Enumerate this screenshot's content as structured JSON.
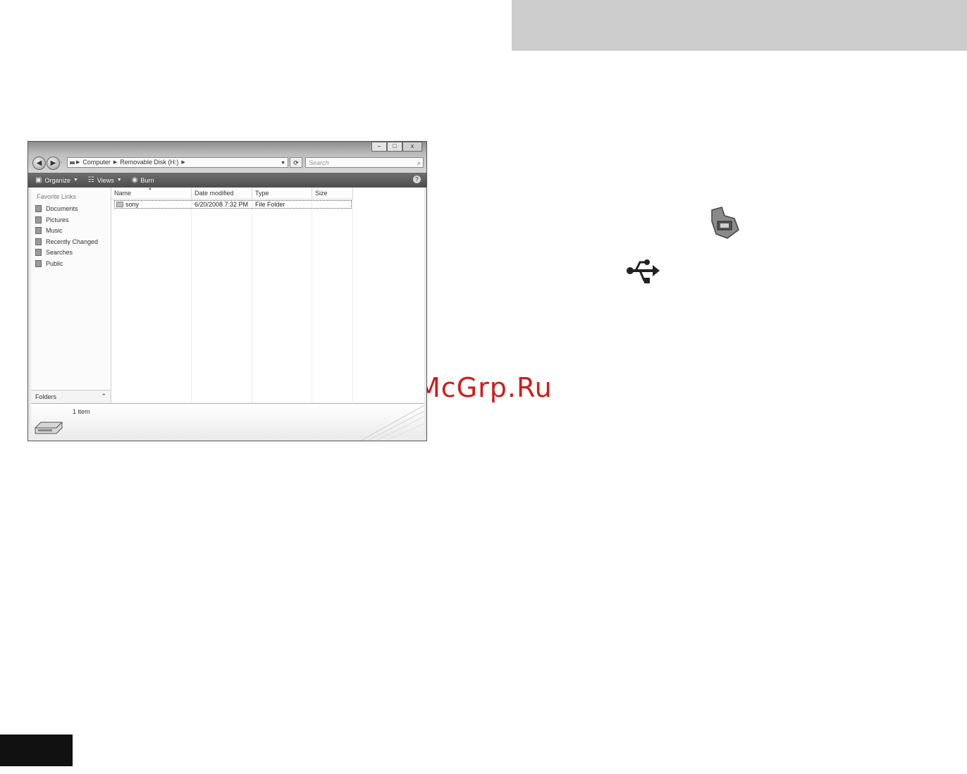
{
  "window": {
    "controls": {
      "minimize": "–",
      "maximize": "□",
      "close": "x"
    },
    "nav": {
      "back": "◀",
      "forward": "▶",
      "history": "·"
    },
    "breadcrumb": [
      "Computer",
      "Removable Disk (H:)"
    ],
    "search_placeholder": "Search",
    "toolbar": {
      "organize_label": "Organize",
      "views_label": "Views",
      "burn_label": "Burn"
    },
    "nav_pane": {
      "heading": "Favorite Links",
      "items": [
        "Documents",
        "Pictures",
        "Music",
        "Recently Changed",
        "Searches",
        "Public"
      ],
      "folders_label": "Folders"
    },
    "columns": [
      "Name",
      "Date modified",
      "Type",
      "Size"
    ],
    "rows": [
      {
        "name": "sony",
        "date_modified": "6/20/2008 7:32 PM",
        "type": "File Folder",
        "size": ""
      }
    ],
    "details": {
      "item_count": "1 item"
    }
  },
  "watermark": "McGrp.Ru",
  "colors": {
    "banner": "#cccccc",
    "toolbar": "#5a5a5a",
    "watermark": "#d11b1b",
    "page_tab": "#111111"
  }
}
